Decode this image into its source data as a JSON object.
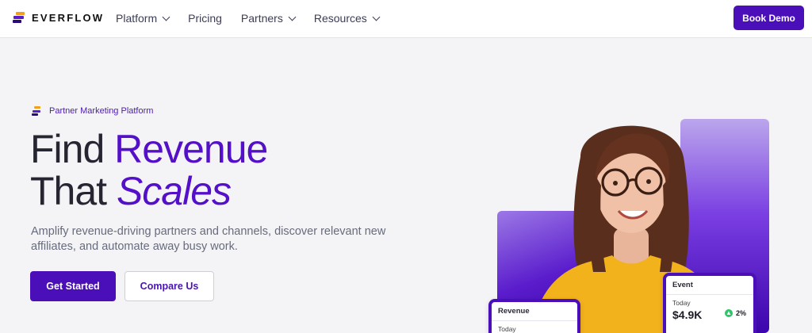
{
  "nav": {
    "brand": "EVERFLOW",
    "links": [
      {
        "label": "Platform",
        "dropdown": true
      },
      {
        "label": "Pricing",
        "dropdown": false
      },
      {
        "label": "Partners",
        "dropdown": true
      },
      {
        "label": "Resources",
        "dropdown": true
      }
    ],
    "cta": "Book Demo"
  },
  "hero": {
    "eyebrow": "Partner Marketing Platform",
    "headline_line1_plain": "Find ",
    "headline_line1_accent": "Revenue",
    "headline_line2_plain": "That ",
    "headline_line2_accent": "Scales",
    "subtitle": "Amplify revenue-driving partners and channels, discover relevant new affiliates, and automate away busy work.",
    "primary_cta": "Get Started",
    "secondary_cta": "Compare Us"
  },
  "cards": {
    "event": {
      "title": "Event",
      "period": "Today",
      "value": "$4.9K",
      "change": "2%"
    },
    "revenue": {
      "title": "Revenue",
      "period": "Today"
    }
  },
  "colors": {
    "brand": "#4a0fb8",
    "accent_text": "#5310c8",
    "positive": "#2ec46a"
  },
  "icons": {
    "logo": "everflow-logo-icon",
    "dropdown": "chevron-down-icon",
    "change": "arrow-up-icon"
  }
}
